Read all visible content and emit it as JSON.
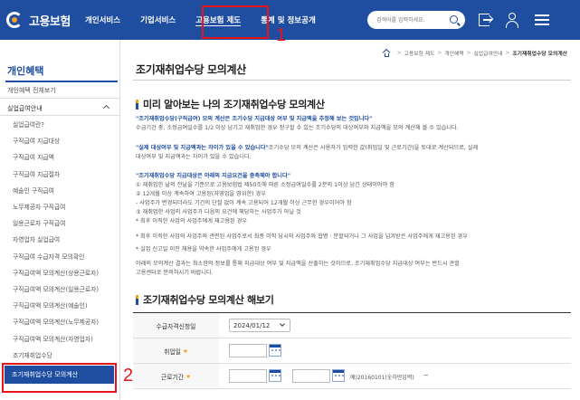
{
  "header": {
    "logo_text": "고용보험",
    "gnb": [
      "개인서비스",
      "기업서비스",
      "고용보험 제도",
      "통계 및 정보공개"
    ],
    "search_placeholder": "검색어를 입력하세요."
  },
  "annotations": {
    "num1": "1",
    "num2": "2",
    "color": "#e8141c"
  },
  "sidebar": {
    "title": "개인혜택",
    "all": "개인혜택 전체보기",
    "category": "실업급여안내",
    "items": [
      "실업급여란?",
      "구직급여 지급대상",
      "구직급여 지급액",
      "구직급여 지급절차",
      "예술인 구직급여",
      "노무제공자 구직급여",
      "일용근로자 구직급여",
      "자영업자 실업급여",
      "구직급여 수급자격 모의확인",
      "구직급여액 모의계산(상용근로자)",
      "구직급여액 모의계산(일용근로자)",
      "구직급여액 모의계산(예술인)",
      "구직급여액 모의계산(노무제공자)",
      "구직급여액 모의계산(자영업자)",
      "조기재취업수당"
    ],
    "active": "조기재취업수당 모의계산"
  },
  "breadcrumb": [
    "고용보험 제도",
    "개인혜택",
    "실업급여안내",
    "조기재취업수당 모의계산"
  ],
  "page_title": "조기재취업수당 모의계산",
  "section1": {
    "title": "미리 알아보는 나의 조기재취업수당 모의계산",
    "p1_hl": "\"조기재취업수당(구직급여) 모의 계산은 조기수당 지급대상 여부 및 지급액을 추정해 보는 것입니다\"",
    "p1_body": "수급기간 중, 소정급여일수를 1/2 이상 남기고 재취업한 경우 청구할 수 있는 조기수당의 대상여부와 지급액을 모의 계산해 볼 수 있습니다.",
    "p2_hl": "\"실제 대상여부 및 지급액과는 차이가 있을 수 있습니다\"",
    "p2_rest": "조기수당 모의 계산은 사용자가 입력한 값(취업일 및 근로기간)을 토대로 계산되므로, 실제",
    "p2_line2": "대상여부 및 지급액과는 차이가 있을 수 있습니다.",
    "p3_hl": "\"조기재취업수당 지급대상은 아래의 지급요건을 충족해야 합니다\"",
    "p3_lines": [
      "① 재취업한 날의 전날을 기준으로 고용보험법 제50조에 따른 소정급여일수를 2분의 1이상 남긴 상태이어야 함",
      "② 12개월 이상 계속하여 고용된(자영업을 영위한) 경우",
      " - 사업주가 변경되더라도 기간의 단절 없이 계속 고용되어 12개월 이상 근무한 경우이어야 함",
      "③ 재취업한 사업의 사업주가 다음의 요건에 해당하는 사업주가 아닐 것",
      " * 최후 이직한 사업의 사업주에게 재고용된 경우",
      " * 최후 이직한 사업의 사업주와 관련된 사업주로서 최종 이직 당시의 사업주와 합병 · 분할되거나 그 사업을 넘겨받은 사업주에게 재고용된 경우",
      " * 실업 신고일 이전 채용을 약속한 사업주에게 고용된 경우"
    ],
    "p4_lines": [
      "아래의 모의계산 결과는 최소한의 정보를 통해 지급대상 여부 및 지급액을 산출하는 것이므로, 조기재취업수당 지급대상 여부는 반드시 관할",
      "고용센터로 문의하시기 바랍니다."
    ]
  },
  "section2": {
    "title": "조기재취업수당 모의계산 해보기"
  },
  "form": {
    "row1_label": "수급자격신청일",
    "row1_value": "2024/01/12",
    "row2_label": "취업일",
    "row3_label": "근로기간",
    "tilde": "~",
    "example": "예)20160101(숫자만입력)",
    "required_mark": "★"
  }
}
